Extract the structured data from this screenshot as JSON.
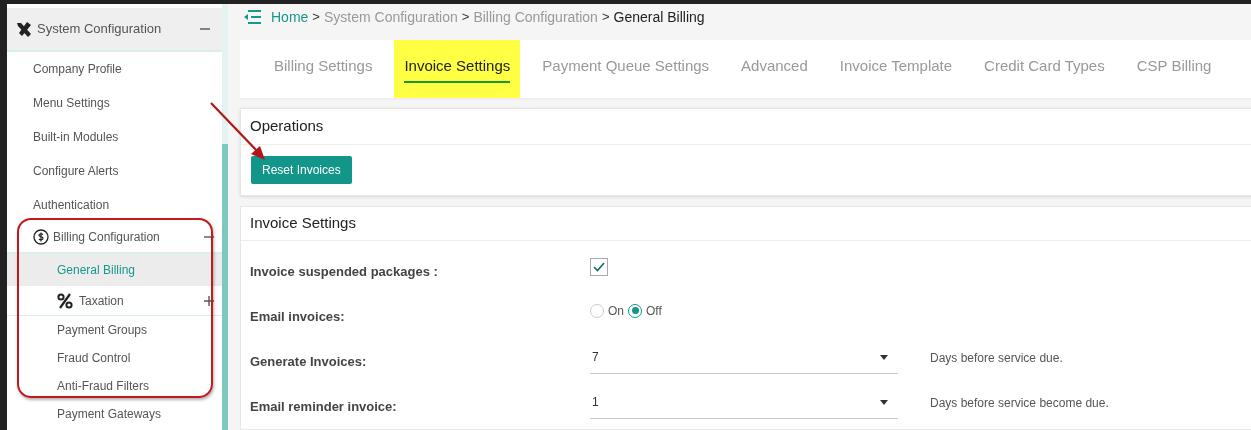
{
  "sidebar": {
    "section": {
      "title": "System Configuration",
      "expanded": true
    },
    "items": [
      {
        "label": "Company Profile",
        "kind": "link",
        "selected": false
      },
      {
        "label": "Menu Settings",
        "kind": "link",
        "selected": false
      },
      {
        "label": "Built-in Modules",
        "kind": "link",
        "selected": false
      },
      {
        "label": "Configure Alerts",
        "kind": "link",
        "selected": false
      },
      {
        "label": "Authentication",
        "kind": "link",
        "selected": false
      },
      {
        "label": "Billing Configuration",
        "kind": "group",
        "expanded": true,
        "children": [
          {
            "label": "General Billing",
            "kind": "link",
            "selected": true
          },
          {
            "label": "Taxation",
            "kind": "group",
            "expanded": false
          },
          {
            "label": "Payment Groups",
            "kind": "link",
            "selected": false
          },
          {
            "label": "Fraud Control",
            "kind": "link",
            "selected": false
          },
          {
            "label": "Anti-Fraud Filters",
            "kind": "link",
            "selected": false
          },
          {
            "label": "Payment Gateways",
            "kind": "link",
            "selected": false
          }
        ]
      }
    ]
  },
  "breadcrumb": [
    {
      "label": "Home",
      "kind": "link"
    },
    {
      "label": "System Configuration",
      "kind": "muted"
    },
    {
      "label": "Billing Configuration",
      "kind": "muted"
    },
    {
      "label": "General Billing",
      "kind": "current"
    }
  ],
  "breadcrumb_separator": ">",
  "tabs": [
    {
      "label": "Billing Settings",
      "selected": false,
      "highlighted": false
    },
    {
      "label": "Invoice Settings",
      "selected": true,
      "highlighted": true
    },
    {
      "label": "Payment Queue Settings",
      "selected": false,
      "highlighted": false
    },
    {
      "label": "Advanced",
      "selected": false,
      "highlighted": false
    },
    {
      "label": "Invoice Template",
      "selected": false,
      "highlighted": false
    },
    {
      "label": "Credit Card Types",
      "selected": false,
      "highlighted": false
    },
    {
      "label": "CSP Billing",
      "selected": false,
      "highlighted": false
    }
  ],
  "operations": {
    "title": "Operations",
    "button": "Reset Invoices"
  },
  "invoice_settings": {
    "title": "Invoice Settings",
    "rows": [
      {
        "kind": "checkbox",
        "label": "Invoice suspended packages :",
        "checked": true
      },
      {
        "kind": "radio",
        "label": "Email invoices:",
        "options": [
          {
            "label": "On",
            "selected": false
          },
          {
            "label": "Off",
            "selected": true
          }
        ]
      },
      {
        "kind": "select",
        "label": "Generate Invoices:",
        "value": "7",
        "note": "Days before service due."
      },
      {
        "kind": "select",
        "label": "Email reminder invoice:",
        "value": "1",
        "note": "Days before service become due."
      }
    ]
  }
}
